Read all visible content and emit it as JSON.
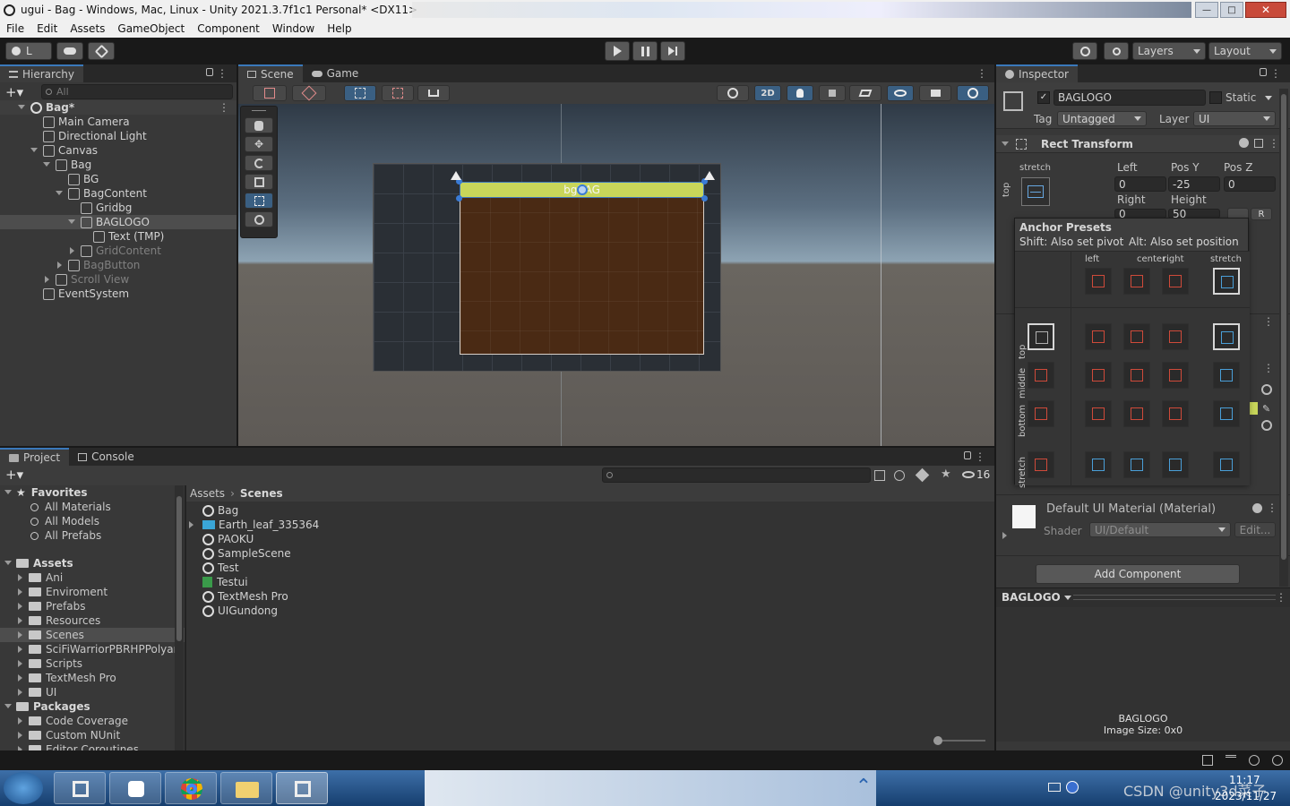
{
  "window": {
    "title": "ugui - Bag - Windows, Mac, Linux - Unity 2021.3.7f1c1 Personal* <DX11>"
  },
  "menu": [
    "File",
    "Edit",
    "Assets",
    "GameObject",
    "Component",
    "Window",
    "Help"
  ],
  "toolbar": {
    "account": "L",
    "layers": "Layers",
    "layout": "Layout"
  },
  "hierarchy": {
    "tab": "Hierarchy",
    "search_placeholder": "All",
    "items": [
      {
        "label": "Bag*",
        "depth": 0,
        "scene": true
      },
      {
        "label": "Main Camera",
        "depth": 1
      },
      {
        "label": "Directional Light",
        "depth": 1
      },
      {
        "label": "Canvas",
        "depth": 1
      },
      {
        "label": "Bag",
        "depth": 2
      },
      {
        "label": "BG",
        "depth": 3
      },
      {
        "label": "BagContent",
        "depth": 3
      },
      {
        "label": "Gridbg",
        "depth": 4
      },
      {
        "label": "BAGLOGO",
        "depth": 4
      },
      {
        "label": "Text (TMP)",
        "depth": 5
      },
      {
        "label": "GridContent",
        "depth": 4
      },
      {
        "label": "BagButton",
        "depth": 3
      },
      {
        "label": "Scroll View",
        "depth": 2
      },
      {
        "label": "EventSystem",
        "depth": 1
      }
    ]
  },
  "scene": {
    "tab_scene": "Scene",
    "tab_game": "Game",
    "mode_2d": "2D",
    "logo_text": "bgBAG"
  },
  "project": {
    "tab_project": "Project",
    "tab_console": "Console",
    "hidden_count": "16",
    "favorites_label": "Favorites",
    "favorites": [
      "All Materials",
      "All Models",
      "All Prefabs"
    ],
    "assets_label": "Assets",
    "assets": [
      "Ani",
      "Enviroment",
      "Prefabs",
      "Resources",
      "Scenes",
      "SciFiWarriorPBRHPPolyart",
      "Scripts",
      "TextMesh Pro",
      "UI"
    ],
    "packages_label": "Packages",
    "packages": [
      "Code Coverage",
      "Custom NUnit",
      "Editor Coroutines"
    ],
    "breadcrumb": [
      "Assets",
      "Scenes"
    ],
    "files": [
      "Bag",
      "Earth_leaf_335364",
      "PAOKU",
      "SampleScene",
      "Test",
      "Testui",
      "TextMesh Pro",
      "UIGundong"
    ]
  },
  "inspector": {
    "tab": "Inspector",
    "name": "BAGLOGO",
    "static_label": "Static",
    "tag_label": "Tag",
    "tag_value": "Untagged",
    "layer_label": "Layer",
    "layer_value": "UI",
    "rect_transform": "Rect Transform",
    "anchor_mode": "stretch",
    "anchor_side": "top",
    "left_label": "Left",
    "left_value": "0",
    "posy_label": "Pos Y",
    "posy_value": "-25",
    "posz_label": "Pos Z",
    "posz_value": "0",
    "right_label": "Right",
    "right_value": "0",
    "height_label": "Height",
    "height_value": "50",
    "r_button": "R",
    "anchor_presets": {
      "title": "Anchor Presets",
      "shift_hint": "Shift: Also set pivot",
      "alt_hint": "Alt: Also set position",
      "cols": [
        "left",
        "center",
        "right",
        "stretch"
      ],
      "rows": [
        "top",
        "middle",
        "bottom",
        "stretch"
      ]
    },
    "material_name": "Default UI Material (Material)",
    "shader_label": "Shader",
    "shader_value": "UI/Default",
    "edit_button": "Edit...",
    "add_component": "Add Component",
    "preview_dropdown": "BAGLOGO",
    "preview_name": "BAGLOGO",
    "preview_size": "Image Size: 0x0"
  },
  "taskbar": {
    "clock_time": "11:17",
    "clock_date": "2023/11/27",
    "watermark": "CSDN @unity3d菜子"
  },
  "colors": {
    "accent": "#3a79bb",
    "selection": "#2c5d87",
    "logo_bar": "#c8d65a",
    "bag_bg": "#4a2a14"
  }
}
